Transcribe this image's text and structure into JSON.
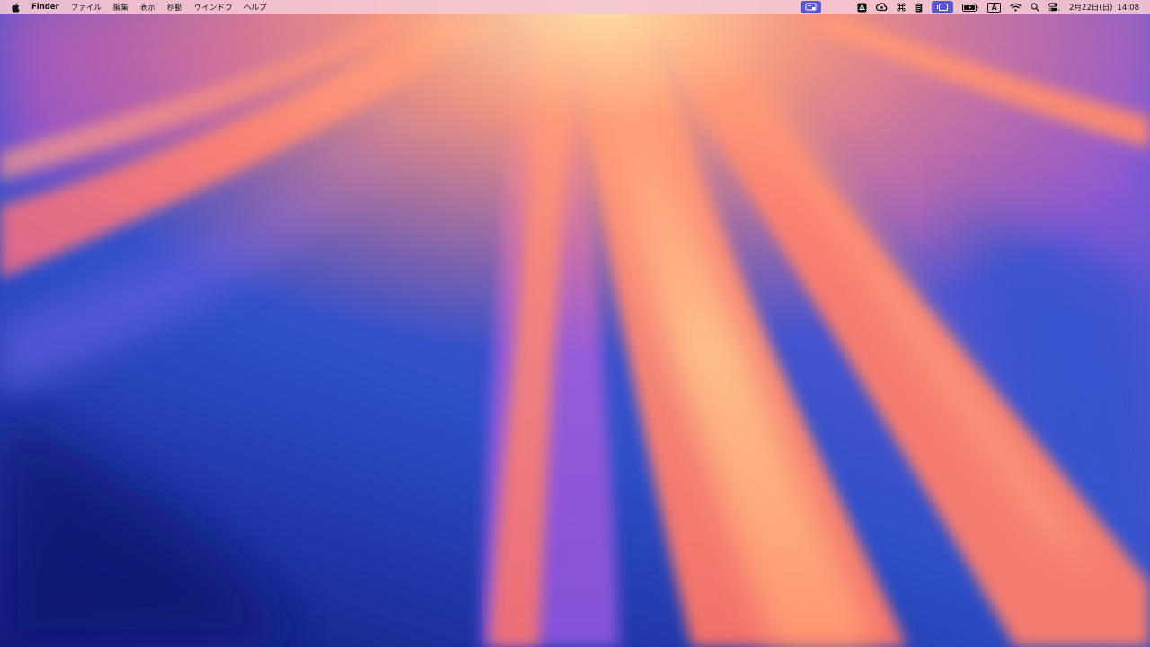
{
  "menubar": {
    "apple_icon": "apple-logo-icon",
    "app_name": "Finder",
    "menus": [
      "ファイル",
      "編集",
      "表示",
      "移動",
      "ウインドウ",
      "ヘルプ"
    ],
    "status_icons": [
      "screen-mirroring-icon",
      "drive-icon",
      "creative-cloud-icon",
      "command-key-icon",
      "clipboard-icon",
      "stage-manager-icon",
      "battery-icon",
      "input-source-icon",
      "wifi-icon",
      "spotlight-search-icon",
      "control-center-icon"
    ],
    "input_source_label": "A",
    "date": "2月22日(日)",
    "time": "14:08",
    "accent_color": "#5a57cf"
  },
  "wallpaper": {
    "name": "macOS Sequoia",
    "colors": [
      "#1a2a9a",
      "#3f5fd8",
      "#9a5ad8",
      "#ff7f6a",
      "#ffc98a"
    ]
  }
}
